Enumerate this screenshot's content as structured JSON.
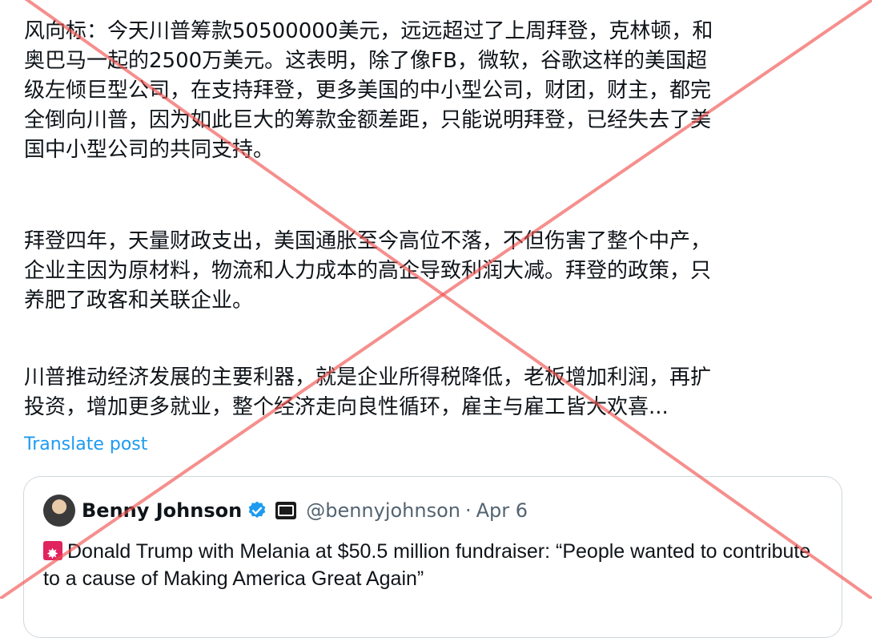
{
  "post": {
    "paragraphs": [
      "风向标：今天川普筹款50500000美元，远远超过了上周拜登，克林顿，和\n奥巴马一起的2500万美元。这表明，除了像FB，微软，谷歌这样的美国超\n级左倾巨型公司，在支持拜登，更多美国的中小型公司，财团，财主，都完\n全倒向川普，因为如此巨大的筹款金额差距，只能说明拜登，已经失去了美\n国中小型公司的共同支持。",
      "拜登四年，天量财政支出，美国通胀至今高位不落，不但伤害了整个中产，\n企业主因为原材料，物流和人力成本的高企导致利润大减。拜登的政策，只\n养肥了政客和关联企业。",
      "川普推动经济发展的主要利器，就是企业所得税降低，老板增加利润，再扩\n投资，增加更多就业，整个经济走向良性循环，雇主与雇工皆大欢喜..."
    ],
    "translate_label": "Translate post"
  },
  "quote": {
    "name": "Benny Johnson",
    "handle": "@bennyjohnson",
    "separator": "·",
    "date": "Apr 6",
    "text": "Donald Trump with Melania at $50.5 million fundraiser: “People wanted to contribute to a cause of Making America Great Again”",
    "icons": [
      "avatar",
      "verified-badge-icon",
      "affiliate-badge-icon",
      "siren-emoji-icon"
    ]
  },
  "colors": {
    "link": "#1d9bf0",
    "text": "#0f1419",
    "muted": "#536471",
    "cross": "#ef5350"
  }
}
